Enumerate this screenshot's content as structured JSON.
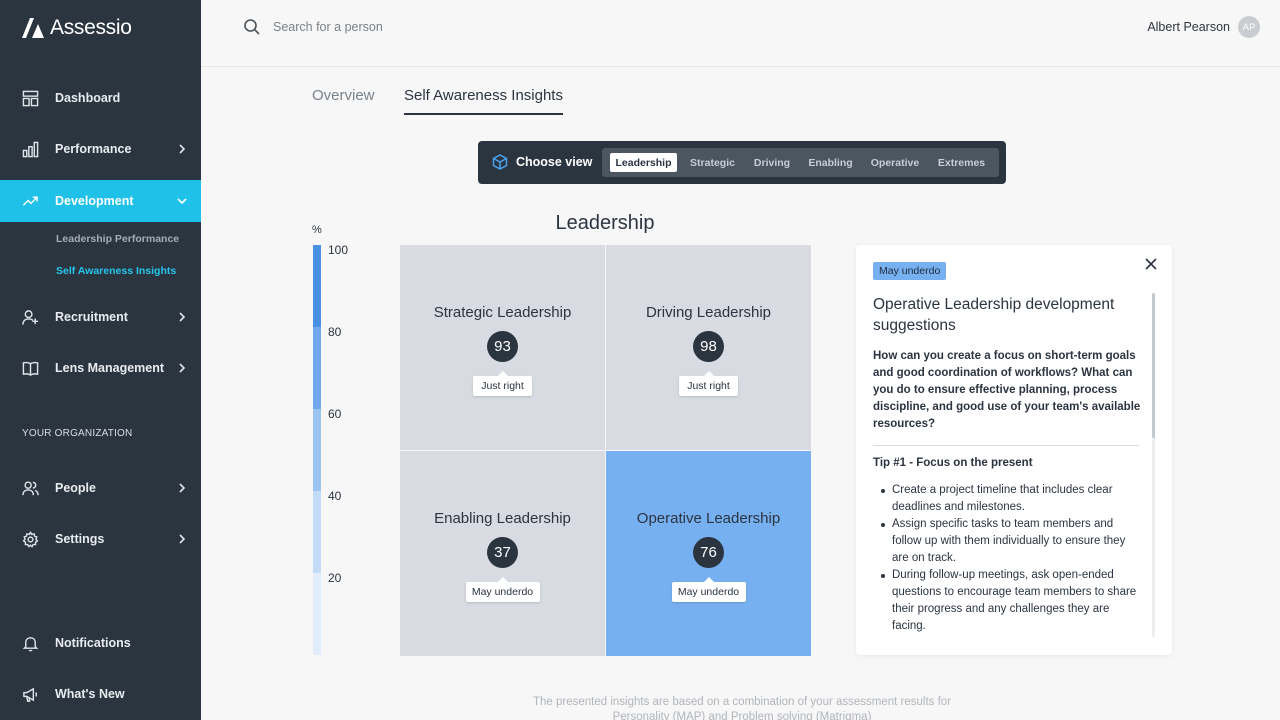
{
  "app": {
    "name": "Assessio"
  },
  "sidebar": {
    "items": [
      {
        "label": "Dashboard"
      },
      {
        "label": "Performance"
      },
      {
        "label": "Development"
      },
      {
        "label": "Recruitment"
      },
      {
        "label": "Lens Management"
      },
      {
        "label": "People"
      },
      {
        "label": "Settings"
      },
      {
        "label": "Notifications"
      },
      {
        "label": "What's New"
      }
    ],
    "sub_items": [
      {
        "label": "Leadership Performance"
      },
      {
        "label": "Self Awareness Insights"
      }
    ],
    "section_label": "YOUR ORGANIZATION"
  },
  "header": {
    "search_placeholder": "Search for a person",
    "user_name": "Albert Pearson",
    "user_initials": "AP"
  },
  "tabs": [
    {
      "label": "Overview"
    },
    {
      "label": "Self Awareness Insights"
    }
  ],
  "view_selector": {
    "label": "Choose view",
    "options": [
      "Leadership",
      "Strategic",
      "Driving",
      "Enabling",
      "Operative",
      "Extremes"
    ],
    "selected": "Leadership"
  },
  "chart_data": {
    "type": "heatmap",
    "title": "Leadership",
    "scale_label": "%",
    "scale_ticks": [
      "100",
      "80",
      "60",
      "40",
      "20"
    ],
    "ylim": [
      0,
      100
    ],
    "quadrants": [
      {
        "name": "Strategic Leadership",
        "value": 93,
        "label": "Just right"
      },
      {
        "name": "Driving Leadership",
        "value": 98,
        "label": "Just right"
      },
      {
        "name": "Enabling Leadership",
        "value": 37,
        "label": "May underdo"
      },
      {
        "name": "Operative Leadership",
        "value": 76,
        "label": "May underdo"
      }
    ],
    "highlighted": "Operative Leadership"
  },
  "panel": {
    "badge": "May underdo",
    "title": "Operative Leadership development suggestions",
    "question": "How can you create a focus on short-term goals and good coordination of workflows? What can you do to ensure effective planning, process discipline, and good use of your team's available resources?",
    "tip_title": "Tip #1 - Focus on the present",
    "tips": [
      "Create a project timeline that includes clear deadlines and milestones.",
      "Assign specific tasks to team members and follow up with them individually to ensure they are on track.",
      "During follow-up meetings, ask open-ended questions to encourage team members to share their progress and any challenges they are facing."
    ]
  },
  "footnote": "The presented insights are based on a combination of your assessment results for Personality (MAP) and Problem solving (Matrigma)",
  "colors": {
    "sidebar_bg": "#2b3540",
    "accent": "#1fc1e8",
    "highlight_quadrant": "#77b0f0",
    "quadrant": "#d8dbe2",
    "scale": [
      "#4a90e2",
      "#6fa8ec",
      "#9bc4f3",
      "#c2dbf7",
      "#e1edfb"
    ]
  }
}
